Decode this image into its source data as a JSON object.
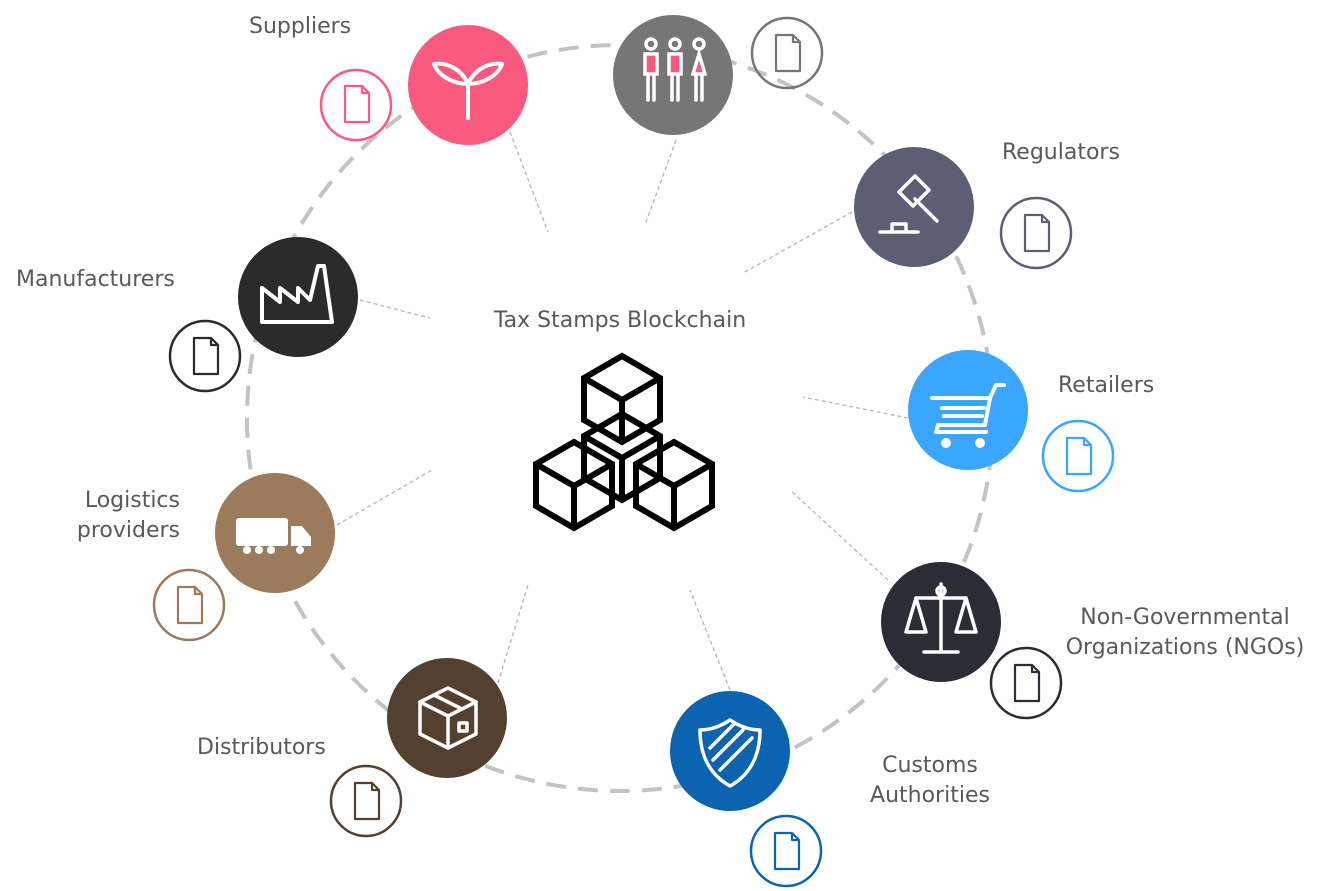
{
  "center": {
    "title": "Tax Stamps Blockchain",
    "icon": "blockchain-cubes-icon"
  },
  "nodes": [
    {
      "key": "suppliers",
      "label": "Suppliers",
      "color": "#fb5a80",
      "icon": "sprout-icon",
      "doc_icon": "document-icon"
    },
    {
      "key": "consumers",
      "label": "",
      "color": "#767676",
      "icon": "people-icon",
      "doc_icon": "document-icon"
    },
    {
      "key": "regulators",
      "label": "Regulators",
      "color": "#5b5f73",
      "icon": "gavel-icon",
      "doc_icon": "document-icon"
    },
    {
      "key": "retailers",
      "label": "Retailers",
      "color": "#3aa6ff",
      "icon": "shopping-cart-icon",
      "doc_icon": "document-icon"
    },
    {
      "key": "ngos",
      "label": "Non-Governmental Organizations (NGOs)",
      "label_lines": [
        "Non-Governmental",
        "Organizations (NGOs)"
      ],
      "color": "#2a2d35",
      "icon": "scales-icon",
      "doc_icon": "document-icon"
    },
    {
      "key": "customs",
      "label": "Customs Authorities",
      "label_lines": [
        "Customs",
        "Authorities"
      ],
      "color": "#0c63b0",
      "icon": "shield-icon",
      "doc_icon": "document-icon"
    },
    {
      "key": "distributors",
      "label": "Distributors",
      "color": "#54402f",
      "icon": "package-box-icon",
      "doc_icon": "document-icon"
    },
    {
      "key": "logistics",
      "label": "Logistics providers",
      "label_lines": [
        "Logistics",
        "providers"
      ],
      "color": "#9c7a5c",
      "icon": "truck-icon",
      "doc_icon": "document-icon"
    },
    {
      "key": "manufacturers",
      "label": "Manufacturers",
      "color": "#2b2b2b",
      "icon": "factory-icon",
      "doc_icon": "document-icon"
    }
  ]
}
